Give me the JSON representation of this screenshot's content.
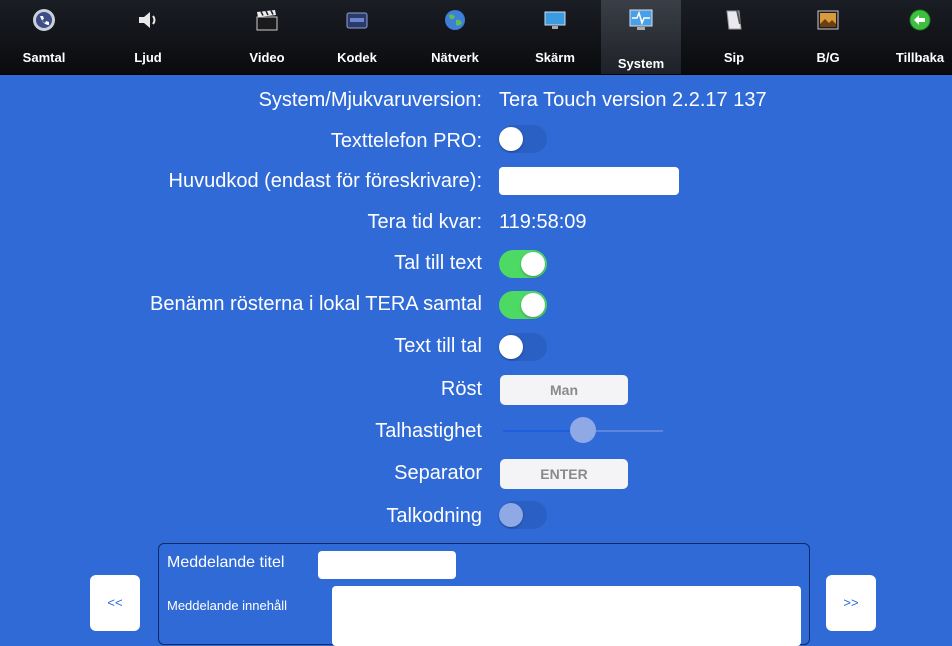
{
  "toolbar": {
    "items": [
      {
        "label": "Samtal",
        "icon": "phone-gear-icon"
      },
      {
        "label": "Ljud",
        "icon": "speaker-icon"
      },
      {
        "label": "Video",
        "icon": "clapperboard-icon"
      },
      {
        "label": "Kodek",
        "icon": "codec-icon"
      },
      {
        "label": "Nätverk",
        "icon": "globe-icon"
      },
      {
        "label": "Skärm",
        "icon": "monitor-icon"
      },
      {
        "label": "System",
        "icon": "system-monitor-icon"
      },
      {
        "label": "Sip",
        "icon": "notepad-icon"
      },
      {
        "label": "B/G",
        "icon": "picture-icon"
      },
      {
        "label": "Tillbaka",
        "icon": "back-arrow-icon"
      }
    ],
    "active": "System"
  },
  "settings": {
    "version_label": "System/Mjukvaruversion:",
    "version_value": "Tera Touch version 2.2.17 137",
    "textphone_label": "Texttelefon PRO:",
    "textphone_on": false,
    "master_code_label": "Huvudkod (endast för föreskrivare):",
    "master_code_value": "",
    "time_left_label": "Tera tid kvar:",
    "time_left_value": "119:58:09",
    "speech_to_text_label": "Tal till text",
    "speech_to_text_on": true,
    "name_voices_label": "Benämn rösterna i lokal TERA samtal",
    "name_voices_on": true,
    "text_to_speech_label": "Text till tal",
    "text_to_speech_on": false,
    "voice_label": "Röst",
    "voice_value": "Man",
    "speech_rate_label": "Talhastighet",
    "speech_rate_fraction": 0.5,
    "separator_label": "Separator",
    "separator_value": "ENTER",
    "speech_coding_label": "Talkodning",
    "speech_coding_on": false
  },
  "message": {
    "title_label": "Meddelande titel",
    "title_value": "",
    "content_label": "Meddelande innehåll",
    "content_value": "",
    "prev_label": "<<",
    "next_label": ">>"
  },
  "colors": {
    "background": "#2f6ad6",
    "switch_on": "#4cd964",
    "toolbar": "#121419"
  }
}
